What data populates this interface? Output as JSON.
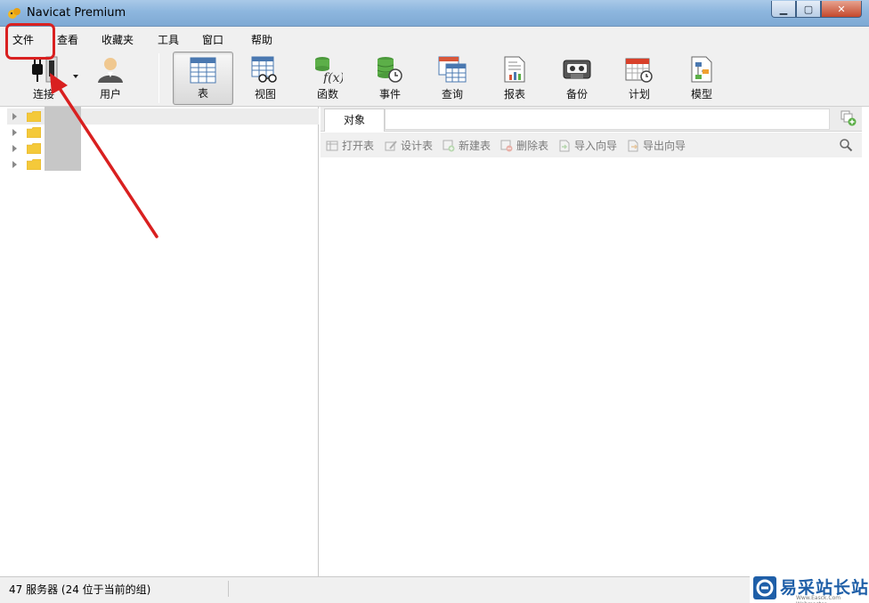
{
  "window": {
    "title": "Navicat Premium",
    "minimize_glyph": "▁",
    "maximize_glyph": "▢",
    "close_glyph": "✕"
  },
  "menu": [
    "文件",
    "查看",
    "收藏夹",
    "工具",
    "窗口",
    "帮助"
  ],
  "toolbar": {
    "connect": "连接",
    "user": "用户",
    "table": "表",
    "view": "视图",
    "function": "函数",
    "event": "事件",
    "query": "查询",
    "report": "报表",
    "backup": "备份",
    "schedule": "计划",
    "model": "模型",
    "active": "表"
  },
  "object_tab": {
    "label": "对象"
  },
  "object_toolbar": [
    "打开表",
    "设计表",
    "新建表",
    "删除表",
    "导入向导",
    "导出向导"
  ],
  "status": {
    "text": "47 服务器 (24 位于当前的组)"
  },
  "watermark": {
    "text": "易采站长站",
    "sub": "Www.Easck.Com Webmaster"
  },
  "colors": {
    "accent_red": "#d92020",
    "title_bar": "#8db6de",
    "folder": "#f4c93a"
  }
}
